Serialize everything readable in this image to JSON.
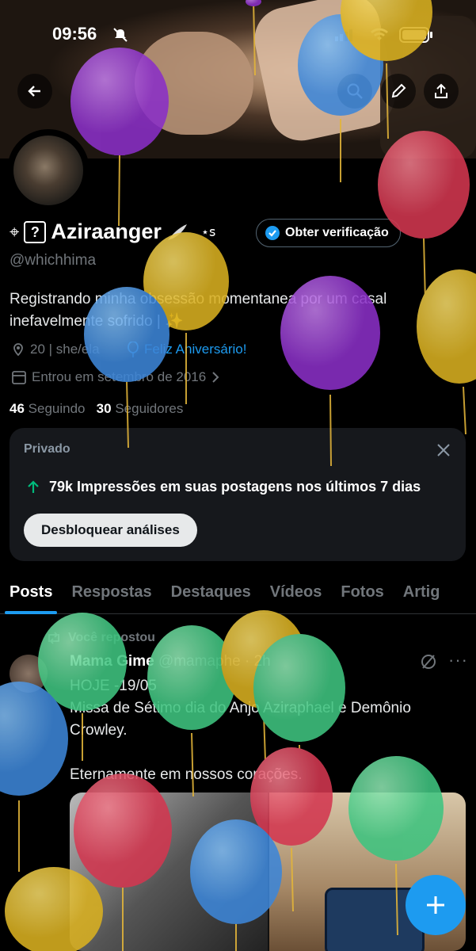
{
  "status_bar": {
    "time": "09:56"
  },
  "profile": {
    "display_name": "Aziraanger",
    "name_prefix_symbols": "⌖",
    "qbox_symbol": "?",
    "handle": "@whichhima",
    "verify_button": "Obter verificação",
    "bio": "Registrando minha obsessão momentanea por um casal inefavelmente sofrido | ✨",
    "location": "20 | she/ela",
    "birthday_text": "Feliz Aniversário!",
    "joined": "Entrou em setembro de 2016",
    "following_count": "46",
    "following_label": "Seguindo",
    "followers_count": "30",
    "followers_label": "Seguidores"
  },
  "analytics_card": {
    "label": "Privado",
    "impressions_text": "79k Impressões em suas postagens nos últimos 7 dias",
    "unlock_button": "Desbloquear análises"
  },
  "tabs": [
    "Posts",
    "Respostas",
    "Destaques",
    "Vídeos",
    "Fotos",
    "Artig"
  ],
  "post": {
    "repost_label": "Você repostou",
    "author_name": "Mama Gime",
    "author_handle": "@mamaphe",
    "time": "2h",
    "line1": "HOJE -19/05",
    "line2": "Missa de Sétimo dia do Anjo Aziraphael e Demônio Crowley.",
    "line3": "Eternamente em nossos corações."
  },
  "colors": {
    "accent": "#1d9bf0",
    "background": "#000000",
    "card": "#16181c",
    "muted": "#71767b"
  },
  "icons": [
    "back-arrow-icon",
    "search-icon",
    "pencil-icon",
    "share-icon",
    "verified-badge-icon",
    "location-pin-icon",
    "balloon-icon",
    "calendar-icon",
    "chevron-right-icon",
    "arrow-up-icon",
    "close-icon",
    "repost-icon",
    "grok-icon",
    "more-icon",
    "plus-icon"
  ]
}
